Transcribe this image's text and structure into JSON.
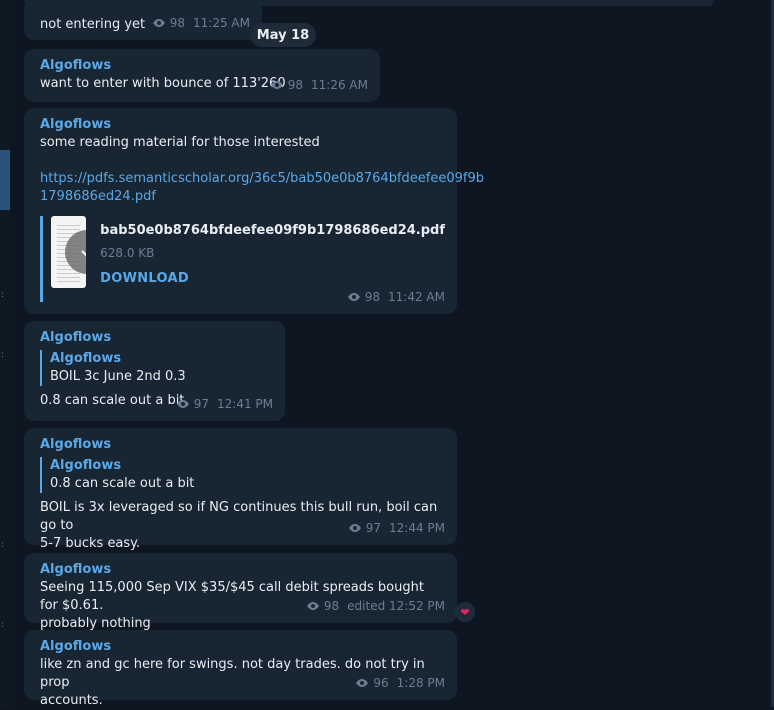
{
  "date_separator": "May 18",
  "messages": [
    {
      "text": "not entering yet",
      "views": "98",
      "time": "11:25 AM"
    },
    {
      "author": "Algoflows",
      "text": "want to enter with bounce of 113'260",
      "views": "98",
      "time": "11:26 AM"
    },
    {
      "author": "Algoflows",
      "text": "some reading material for those interested",
      "link": "https://pdfs.semanticscholar.org/36c5/bab50e0b8764bfdeefee09f9b1798686ed24.pdf",
      "link_line1": "https://pdfs.semanticscholar.org/36c5/bab50e0b8764bfdeefee09f9b",
      "link_line2": "1798686ed24.pdf",
      "file": {
        "name": "bab50e0b8764bfdeefee09f9b1798686ed24.pdf",
        "size": "628.0 KB",
        "action": "DOWNLOAD"
      },
      "views": "98",
      "time": "11:42 AM"
    },
    {
      "author": "Algoflows",
      "quote_author": "Algoflows",
      "quote_text": "BOIL 3c June 2nd 0.3",
      "text": "0.8 can scale out a bit",
      "views": "97",
      "time": "12:41 PM"
    },
    {
      "author": "Algoflows",
      "quote_author": "Algoflows",
      "quote_text": "0.8 can scale out a bit",
      "text_line1": "BOIL is 3x leveraged so if NG continues this bull run, boil can go to",
      "text_line2": "5-7 bucks easy.",
      "views": "97",
      "time": "12:44 PM"
    },
    {
      "author": "Algoflows",
      "text_line1": "Seeing 115,000 Sep VIX $35/$45 call debit spreads bought for $0.61.",
      "text_line2": "probably nothing",
      "views": "98",
      "time": "edited 12:52 PM",
      "reaction": "heart-icon"
    },
    {
      "author": "Algoflows",
      "text_line1": "like zn and gc here for swings. not day trades. do not try in prop",
      "text_line2": "accounts.",
      "views": "96",
      "time": "1:28 PM"
    }
  ],
  "colors": {
    "background": "#0e1621",
    "bubble": "#182533",
    "accent": "#5aa8e8",
    "meta": "#6c7e93",
    "reaction": "#e0245e"
  }
}
